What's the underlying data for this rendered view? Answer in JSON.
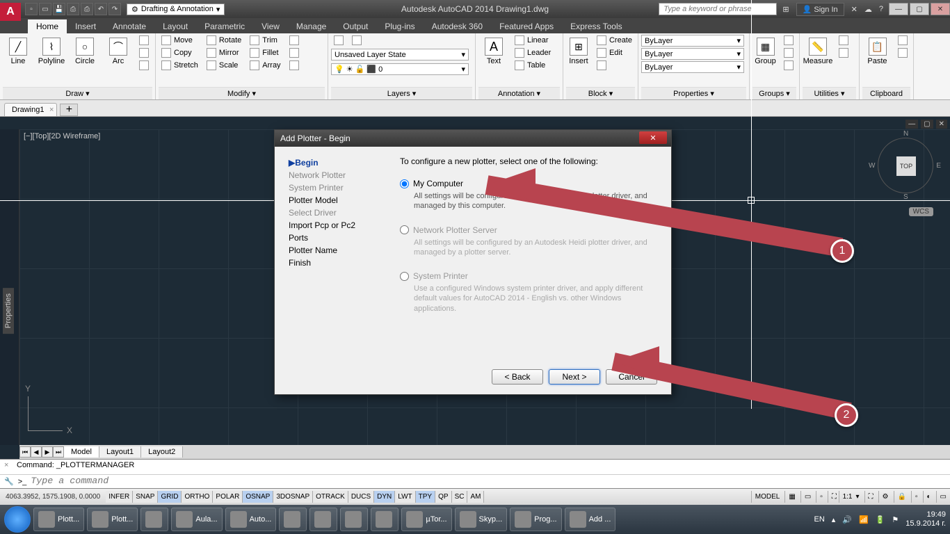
{
  "titlebar": {
    "workspace": "Drafting & Annotation",
    "app_title": "Autodesk AutoCAD 2014   Drawing1.dwg",
    "search_placeholder": "Type a keyword or phrase",
    "signin": "Sign In"
  },
  "menu": {
    "tabs": [
      "Home",
      "Insert",
      "Annotate",
      "Layout",
      "Parametric",
      "View",
      "Manage",
      "Output",
      "Plug-ins",
      "Autodesk 360",
      "Featured Apps",
      "Express Tools"
    ]
  },
  "ribbon": {
    "draw": {
      "title": "Draw ▾",
      "line": "Line",
      "polyline": "Polyline",
      "circle": "Circle",
      "arc": "Arc"
    },
    "modify": {
      "title": "Modify ▾",
      "move": "Move",
      "copy": "Copy",
      "stretch": "Stretch",
      "rotate": "Rotate",
      "mirror": "Mirror",
      "scale": "Scale",
      "trim": "Trim",
      "fillet": "Fillet",
      "array": "Array"
    },
    "layers": {
      "title": "Layers ▾",
      "state": "Unsaved Layer State"
    },
    "annotation": {
      "title": "Annotation ▾",
      "text": "Text",
      "linear": "Linear",
      "leader": "Leader",
      "table": "Table"
    },
    "block": {
      "title": "Block ▾",
      "insert": "Insert",
      "create": "Create",
      "edit": "Edit"
    },
    "properties": {
      "title": "Properties ▾",
      "bylayer1": "ByLayer",
      "bylayer2": "ByLayer",
      "bylayer3": "ByLayer"
    },
    "groups": {
      "title": "Groups ▾",
      "group": "Group"
    },
    "utilities": {
      "title": "Utilities ▾",
      "measure": "Measure"
    },
    "clipboard": {
      "title": "Clipboard",
      "paste": "Paste"
    }
  },
  "file_tabs": {
    "drawing1": "Drawing1"
  },
  "viewport": {
    "label": "[−][Top][2D Wireframe]",
    "wcs": "WCS",
    "top": "TOP",
    "y": "Y",
    "x": "X",
    "n": "N",
    "s": "S",
    "e": "E",
    "w": "W"
  },
  "layout": {
    "model": "Model",
    "layout1": "Layout1",
    "layout2": "Layout2"
  },
  "command": {
    "history": "Command: _PLOTTERMANAGER",
    "prompt": ">_",
    "placeholder": "Type a command"
  },
  "status": {
    "coords": "4063.3952, 1575.1908, 0.0000",
    "toggles": [
      "INFER",
      "SNAP",
      "GRID",
      "ORTHO",
      "POLAR",
      "OSNAP",
      "3DOSNAP",
      "OTRACK",
      "DUCS",
      "DYN",
      "LWT",
      "TPY",
      "QP",
      "SC",
      "AM"
    ],
    "on": [
      "GRID",
      "OSNAP",
      "DYN",
      "TPY"
    ],
    "model": "MODEL",
    "scale": "1:1"
  },
  "dialog": {
    "title": "Add Plotter - Begin",
    "nav": {
      "begin": "Begin",
      "network": "Network Plotter",
      "sysprinter": "System Printer",
      "model": "Plotter Model",
      "driver": "Select Driver",
      "import": "Import Pcp or Pc2",
      "ports": "Ports",
      "name": "Plotter Name",
      "finish": "Finish"
    },
    "intro": "To configure a new plotter, select one of the following:",
    "opt1": {
      "label": "My Computer",
      "desc": "All settings will be configured by an Autodesk Heidi plotter driver, and managed by this computer."
    },
    "opt2": {
      "label": "Network Plotter Server",
      "desc": "All settings will be configured by an Autodesk Heidi plotter driver, and managed by a plotter server."
    },
    "opt3": {
      "label": "System Printer",
      "desc": "Use a configured Windows system printer driver, and apply different default values for AutoCAD 2014 - English vs. other Windows applications."
    },
    "back": "< Back",
    "next": "Next >",
    "cancel": "Cancel"
  },
  "taskbar": {
    "items": [
      "Plott...",
      "Plott...",
      "",
      "Aula...",
      "Auto...",
      "",
      "",
      "",
      "",
      "µTor...",
      "Skyp...",
      "Prog...",
      "Add ..."
    ],
    "lang": "EN",
    "time": "19:49",
    "date": "15.9.2014 г."
  },
  "annotations": {
    "one": "1",
    "two": "2"
  }
}
